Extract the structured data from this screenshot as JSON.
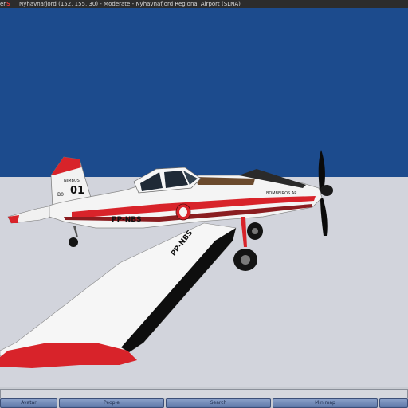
{
  "titlebar": {
    "left_fragment": "er",
    "app_icon": "S",
    "app_icon_accent": "S",
    "title": "Nyhavnafjord (152, 155, 30) - Moderate - Nyhavnafjord Regional Airport (SLNA)"
  },
  "aircraft": {
    "registration": "PP-NBS",
    "wing_registration": "PP-NBS",
    "tail_brand": "NIMBUS",
    "tail_number": "01",
    "tail_code": "B0",
    "fuselage_text": "BOMBEIROS AR"
  },
  "bottombar": {
    "tabs": [
      "Avatar",
      "People",
      "Search",
      "Minimap",
      ""
    ]
  },
  "colors": {
    "sky": "#1c4b8d",
    "ground": "#d2d4dc",
    "livery_red": "#d8232a",
    "tab_blue": "#6f87b6"
  }
}
